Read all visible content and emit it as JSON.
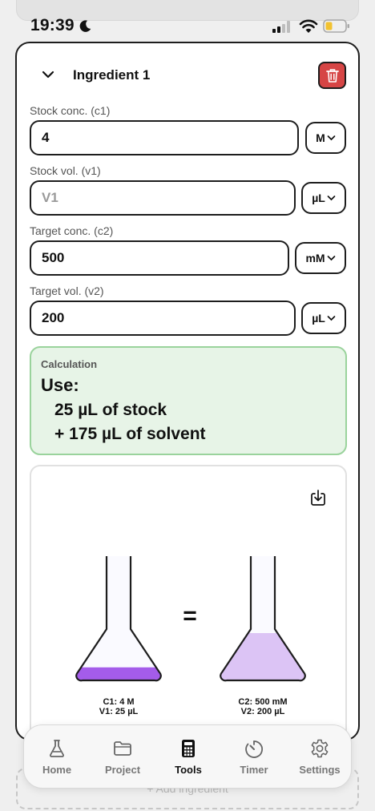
{
  "status": {
    "time": "19:39"
  },
  "ingredient": {
    "title": "Ingredient 1",
    "stock_conc": {
      "label": "Stock conc. (c1)",
      "value": "4",
      "unit": "M"
    },
    "stock_vol": {
      "label": "Stock vol. (v1)",
      "value": "",
      "placeholder": "V1",
      "unit": "µL"
    },
    "target_conc": {
      "label": "Target conc. (c2)",
      "value": "500",
      "unit": "mM"
    },
    "target_vol": {
      "label": "Target vol. (v2)",
      "value": "200",
      "unit": "µL"
    }
  },
  "calculation": {
    "label": "Calculation",
    "use": "Use:",
    "line1": "25 µL of stock",
    "line2": "+ 175 µL of solvent"
  },
  "visual": {
    "equals": "=",
    "left": {
      "c": "C1: 4 M",
      "v": "V1: 25 µL",
      "fill_fraction": 0.125,
      "color": "#a45cea"
    },
    "right": {
      "c": "C2: 500 mM",
      "v": "V2: 200 µL",
      "fill_fraction": 1.0,
      "color": "#dcc4f5"
    }
  },
  "add_ingredient": "+ Add ingredient",
  "tabs": [
    {
      "label": "Home",
      "icon": "flask-icon",
      "active": false
    },
    {
      "label": "Project",
      "icon": "folder-icon",
      "active": false
    },
    {
      "label": "Tools",
      "icon": "calculator-icon",
      "active": true
    },
    {
      "label": "Timer",
      "icon": "timer-icon",
      "active": false
    },
    {
      "label": "Settings",
      "icon": "gear-icon",
      "active": false
    }
  ],
  "colors": {
    "delete": "#d64545",
    "calc_bg": "#e7f4e7",
    "calc_border": "#9ad39c",
    "flask_dark": "#a45cea",
    "flask_light": "#dcc4f5"
  }
}
